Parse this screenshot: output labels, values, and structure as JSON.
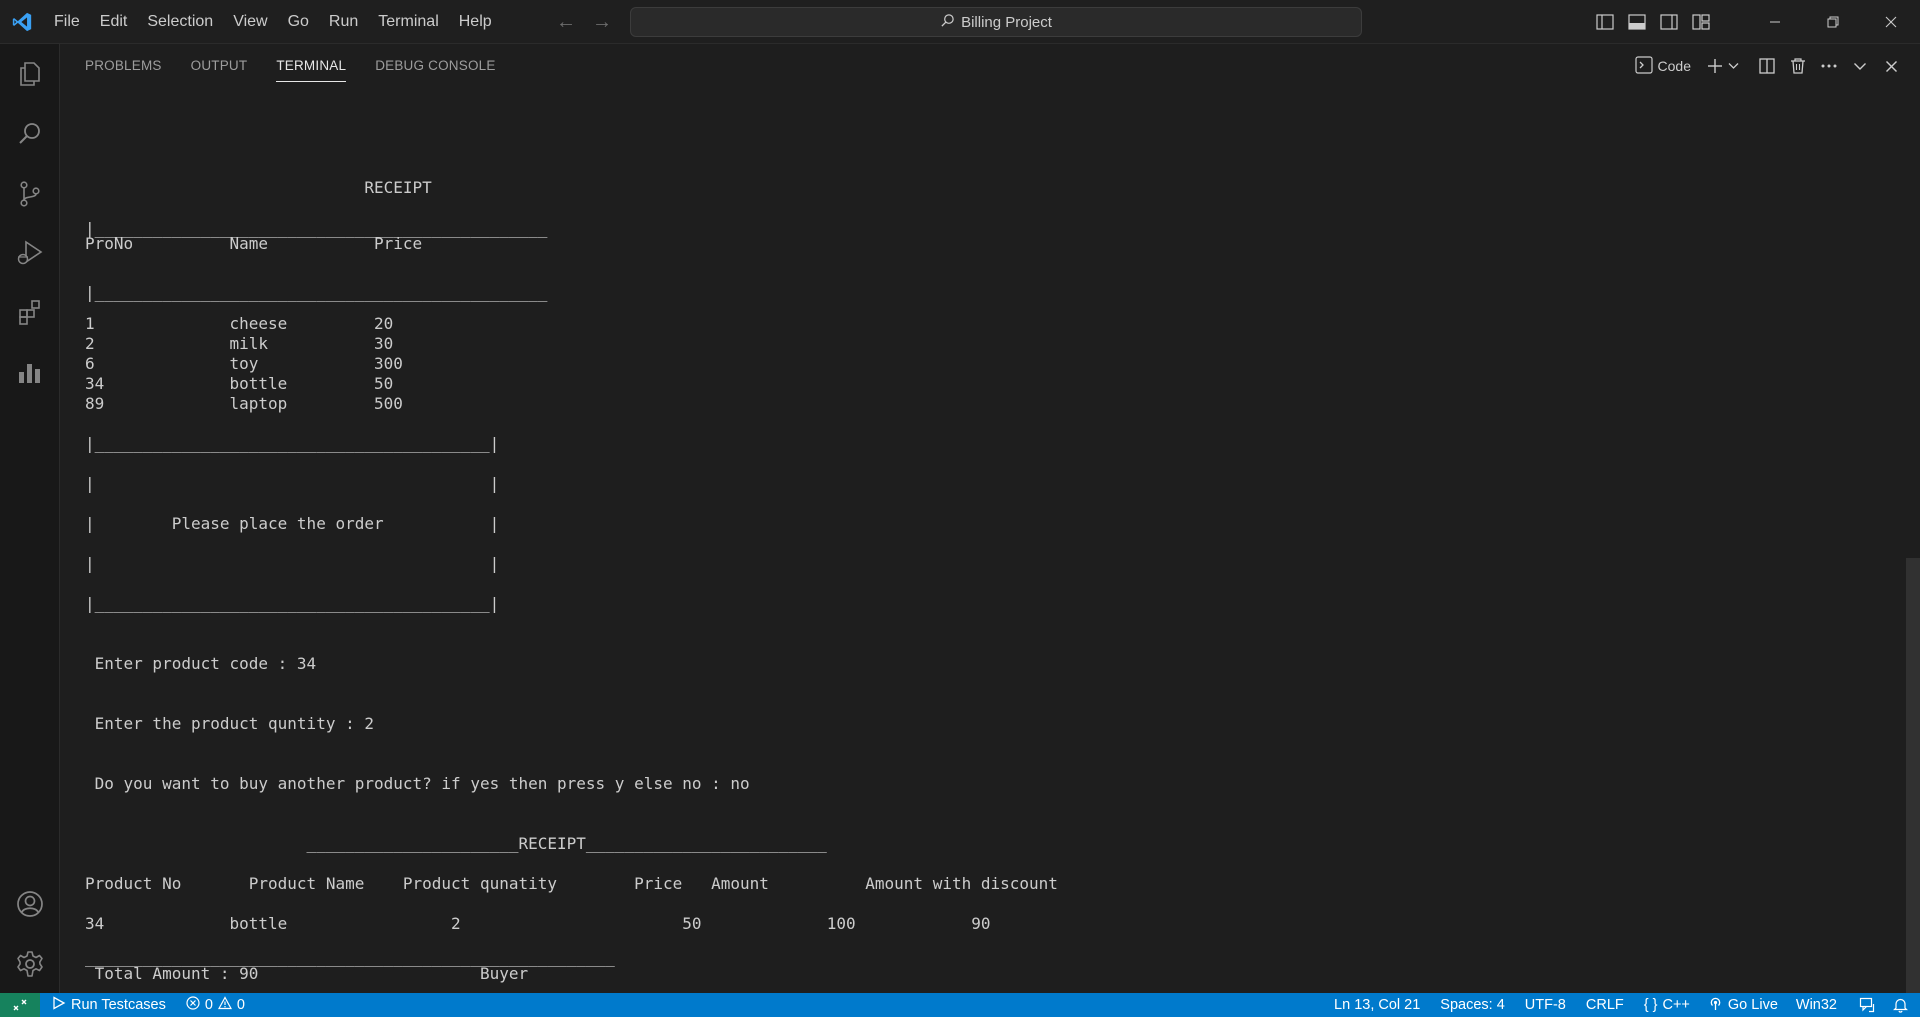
{
  "titlebar": {
    "menu": [
      "File",
      "Edit",
      "Selection",
      "View",
      "Go",
      "Run",
      "Terminal",
      "Help"
    ],
    "search_text": "Billing Project",
    "accent": "#0078d4"
  },
  "panel": {
    "tabs": [
      "PROBLEMS",
      "OUTPUT",
      "TERMINAL",
      "DEBUG CONSOLE"
    ],
    "active_tab": "TERMINAL",
    "terminal_profile": "Code"
  },
  "terminal": {
    "lines": [
      "                             RECEIPT",
      "|_______________________________________________",
      "ProNo          Name           Price",
      "|_______________________________________________",
      "1              cheese         20",
      "2              milk           30",
      "6              toy            300",
      "34             bottle         50",
      "89             laptop         500",
      "|_________________________________________|",
      "|                                         |",
      "|        Please place the order           |",
      "|                                         |",
      "|_________________________________________|",
      " Enter product code : 34",
      " Enter the product quntity : 2",
      " Do you want to buy another product? if yes then press y else no : no",
      "                       ______________________RECEIPT_________________________",
      "Product No       Product Name    Product qunatity        Price   Amount          Amount with discount",
      "34             bottle                 2                       50             100            90",
      "_______________________________________________________",
      " Total Amount : 90                       Buyer",
      "                       _______________"
    ]
  },
  "statusbar": {
    "run_testcases": "Run Testcases",
    "errors": "0",
    "warnings": "0",
    "cursor": "Ln 13, Col 21",
    "spaces": "Spaces: 4",
    "encoding": "UTF-8",
    "eol": "CRLF",
    "language": "C++",
    "go_live": "Go Live",
    "platform": "Win32",
    "color": "#007acc",
    "remote_color": "#16825d"
  }
}
